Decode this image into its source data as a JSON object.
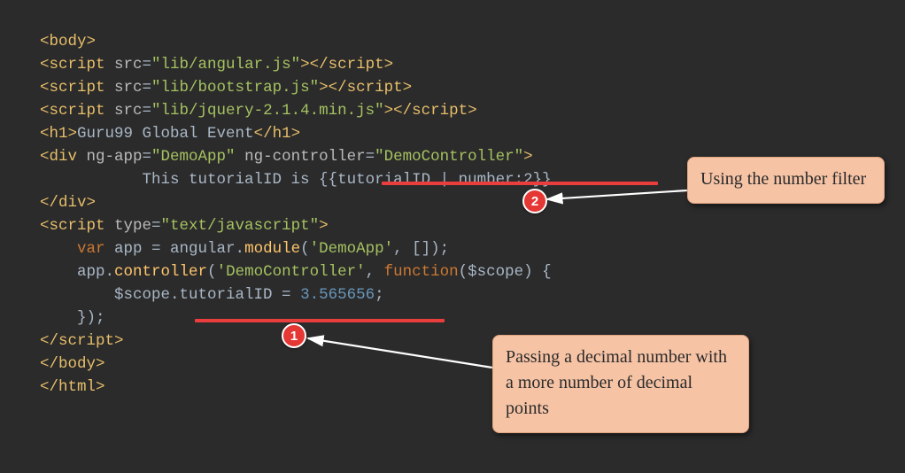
{
  "code": {
    "l1": {
      "a": "<body>"
    },
    "l2": {
      "a": "<script ",
      "b": "src",
      "c": "=",
      "d": "\"lib/angular.js\"",
      "e": "></",
      "f": "script",
      "g": ">"
    },
    "l3": {
      "a": "<script ",
      "b": "src",
      "c": "=",
      "d": "\"lib/bootstrap.js\"",
      "e": "></",
      "f": "script",
      "g": ">"
    },
    "l4": {
      "a": "<script ",
      "b": "src",
      "c": "=",
      "d": "\"lib/jquery-2.1.4.min.js\"",
      "e": "></",
      "f": "script",
      "g": ">"
    },
    "l5": {
      "a": "<h1>",
      "b": "Guru99 Global Event",
      "c": "</h1>"
    },
    "l6": {
      "a": "<div ",
      "b": "ng-app",
      "c": "=",
      "d": "\"DemoApp\" ",
      "e": "ng-controller",
      "f": "=",
      "g": "\"DemoController\"",
      "h": ">"
    },
    "l7": {
      "a": "           This tutorialID is {{",
      "b": "tutorialID | number:2",
      "c": "}}"
    },
    "l8": {
      "a": "</div>"
    },
    "l9": {
      "a": "<script ",
      "b": "type",
      "c": "=",
      "d": "\"text/javascript\"",
      "e": ">"
    },
    "l10": {
      "a": "    ",
      "b": "var ",
      "c": "app = angular.",
      "d": "module",
      "e": "(",
      "f": "'DemoApp'",
      "g": ", []);"
    },
    "l11": {
      "a": "    app.",
      "b": "controller",
      "c": "(",
      "d": "'DemoController'",
      "e": ", ",
      "f": "function",
      "g": "($scope) {"
    },
    "l12": {
      "a": "        $scope.tutorialID = ",
      "b": "3.565656",
      "c": ";"
    },
    "l13": {
      "a": "    });"
    },
    "l14": {
      "a": "</",
      "b": "script",
      "c": ">"
    },
    "l15": {
      "a": "</body>"
    },
    "l16": {
      "a": "</html>"
    }
  },
  "badges": {
    "one": "1",
    "two": "2"
  },
  "callouts": {
    "c1": "Using the number filter",
    "c2": "Passing a decimal number with a more number of decimal points"
  }
}
